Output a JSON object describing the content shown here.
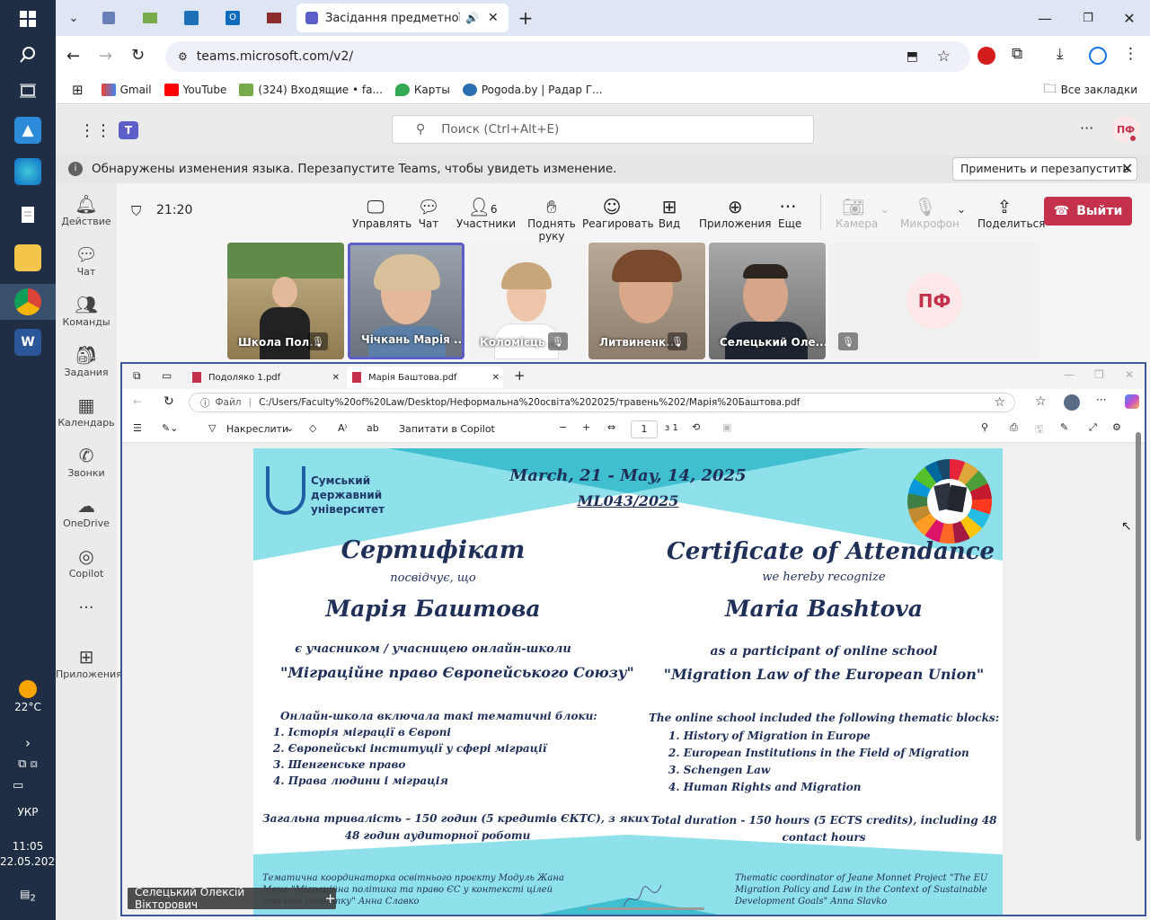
{
  "taskbar": {
    "weather_temp": "22°C",
    "language": "УКР",
    "time": "11:05",
    "date": "22.05.2025",
    "notifications_count": "2"
  },
  "browser": {
    "tabs": [
      {
        "title": "Засідання предметної ком",
        "active": true
      }
    ],
    "url": "teams.microsoft.com/v2/",
    "bookmarks": [
      "Gmail",
      "YouTube",
      "(324) Входящие • fa...",
      "Карты",
      "Pogoda.by | Радар Г..."
    ],
    "all_bookmarks": "Все закладки"
  },
  "teams": {
    "search_placeholder": "Поиск (Ctrl+Alt+E)",
    "avatar_initials": "ПФ",
    "info_message": "Обнаружены изменения языка. Перезапустите Teams, чтобы увидеть изменение.",
    "info_button": "Применить и перезапустить",
    "rail": [
      "Действие",
      "Чат",
      "Команды",
      "Задания",
      "Календарь",
      "Звонки",
      "OneDrive",
      "Copilot",
      "Приложения"
    ],
    "meeting_time": "21:20",
    "controls": {
      "manage": "Управлять",
      "chat": "Чат",
      "participants": "Участники",
      "participants_count": "6",
      "raise_hand": "Поднять руку",
      "react": "Реагировать",
      "view": "Вид",
      "apps": "Приложения",
      "more": "Еще",
      "camera": "Камера",
      "mic": "Микрофон",
      "share": "Поделиться",
      "leave": "Выйти"
    },
    "participants": [
      {
        "name": "Школа Пол..."
      },
      {
        "name": "Чічкань Марія ..."
      },
      {
        "name": "Коломієць ..."
      },
      {
        "name": "Литвиненк..."
      },
      {
        "name": "Селецький Оле..."
      },
      {
        "name": "",
        "initials": "ПФ"
      }
    ],
    "presenter": "Селецький Олексій Вікторович"
  },
  "pdf": {
    "tabs": [
      "Подоляко 1.pdf",
      "Марія Баштова.pdf"
    ],
    "file_label": "Файл",
    "path": "C:/Users/Faculty%20of%20Law/Desktop/Неформальна%20освіта%202025/травень%202/Марія%20Баштова.pdf",
    "draw_label": "Накреслити",
    "copilot_label": "Запитати в Copilot",
    "page_current": "1",
    "page_total": "з 1"
  },
  "certificate": {
    "university": [
      "Сумський",
      "державний",
      "університет"
    ],
    "dates": "March, 21 - May, 14, 2025",
    "code": "ML043/2025",
    "ua": {
      "title": "Сертифікат",
      "sub": "посвідчує, що",
      "name": "Марія Баштова",
      "participant": "є учасником / учасницею онлайн-школи",
      "school": "\"Міграційне право Європейського Союзу\"",
      "blocks_intro": "Онлайн-школа включала такі тематичні блоки:",
      "blocks": [
        "1. Історія міграції в Європі",
        "2. Європейські інституції у сфері міграції",
        "3.  Шенгенське право",
        "4. Права людини і міграція"
      ],
      "duration1": "Загальна тривалість – 150 годин (5 кредитів ЄКТС), з яких",
      "duration2": "48 годин аудиторної роботи",
      "coord1": "Тематична координаторка освітнього проєкту Модуль Жана",
      "coord2": "Моне \"Міграційна політика та право ЄС у контексті цілей",
      "coord3": "сталого розвитку\" Анна Славко"
    },
    "en": {
      "title": "Certificate of Attendance",
      "sub": "we hereby recognize",
      "name": "Maria Bashtova",
      "participant": "as a participant of online school",
      "school": "\"Migration Law of the European Union\"",
      "blocks_intro": "The online school included the following thematic blocks:",
      "blocks": [
        "1. History of Migration in Europe",
        "2. European Institutions in the Field of Migration",
        "3. Schengen Law",
        "4. Human Rights and Migration"
      ],
      "duration1": "Total duration - 150 hours (5 ECTS credits), including 48",
      "duration2": "contact hours",
      "coord1": "Thematic coordinator of Jeane Monnet Project \"The EU",
      "coord2": "Migration Policy and Law in the Context of Sustainable",
      "coord3": "Development Goals\" Anna Slavko"
    }
  },
  "colors": {
    "teams_accent": "#5b5fc7",
    "leave_red": "#c4314b",
    "cert_cyan": "#8ee0ea",
    "cert_navy": "#1f2f58"
  }
}
